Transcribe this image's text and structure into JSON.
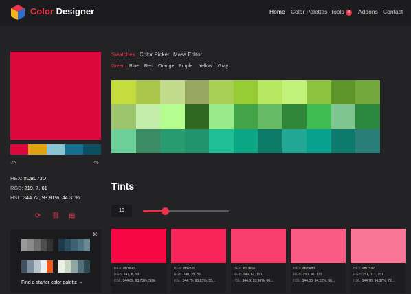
{
  "header": {
    "brand_prefix": "Color",
    "brand_suffix": " Designer",
    "nav": [
      "Home",
      "Color Palettes",
      "Tools",
      "Addons",
      "Contact"
    ],
    "tools_badge": "8"
  },
  "color": {
    "hex_value": "#DB073D",
    "hex_label": "HEX: ",
    "rgb_label": "RGB: ",
    "rgb": "219, 7, 61",
    "hsl_label": "HSL: ",
    "hsl": "344.72, 93.81%, 44.31%"
  },
  "palette": [
    "#DB073D",
    "#E0A30F",
    "#89C4D3",
    "#136E90",
    "#0B4F62"
  ],
  "starter": {
    "find_label": "Find a starter color palette",
    "palettes": [
      [
        "#9a9a9a",
        "#8a8a8a",
        "#6e6e6e",
        "#4e4e4e",
        "#333333"
      ],
      [
        "#1f3a4a",
        "#2c4d5e",
        "#3f6070",
        "#4f7282",
        "#6c8a96"
      ],
      [
        "#3f5161",
        "#7d8f9f",
        "#b6c4ce",
        "#eaeef0",
        "#ef5a21"
      ],
      [
        "#eaf0e3",
        "#c9d6c2",
        "#8fa7a1",
        "#50717a",
        "#2d4853"
      ]
    ]
  },
  "tabs": [
    "Swatches",
    "Color Picker",
    "Mass Editor"
  ],
  "subtabs": [
    "Green",
    "Blue",
    "Red",
    "Orange",
    "Purple",
    "Yellow",
    "Gray"
  ],
  "swatches": [
    "#c5dc3f",
    "#abc74b",
    "#c2da8c",
    "#98a860",
    "#a8d057",
    "#98cc35",
    "#b7e660",
    "#c2f17a",
    "#8cc440",
    "#5d952a",
    "#73a83c",
    "#9cc46d",
    "#c4ecaa",
    "#b6fd8f",
    "#2f6720",
    "#99ea8b",
    "#44a448",
    "#67bb67",
    "#2f8538",
    "#41bc53",
    "#7ec592",
    "#2a883f",
    "#6ccf97",
    "#3b8b64",
    "#2a9a70",
    "#21926c",
    "#1fbf96",
    "#0ba684",
    "#0d7a67",
    "#23a795",
    "#0aa090",
    "#0e7a6e",
    "#2a7e79"
  ],
  "tints": {
    "title": "Tints",
    "steps": "10",
    "hex_label": "HEX:",
    "rgb_label": "RGB:",
    "hsl_label": "HSL:",
    "items": [
      {
        "color": "#f70845",
        "hex": "#f70845",
        "rgb": "247, 8, 69",
        "hsl": "344.69, 93.73%, 50%"
      },
      {
        "color": "#f82359",
        "hex": "#f82359",
        "rgb": "248, 35, 89",
        "hsl": "344.79, 93.83%, 55..."
      },
      {
        "color": "#f93e6e",
        "hex": "#f93e6e",
        "rgb": "249, 62, 110",
        "hsl": "344.6, 93.96%, 60..."
      },
      {
        "color": "#fa5a83",
        "hex": "#fa5a83",
        "rgb": "250, 90, 131",
        "hsl": "344.63, 94.12%, 66..."
      },
      {
        "color": "#fb7597",
        "hex": "#fb7597",
        "rgb": "251, 117, 151",
        "hsl": "344.78, 94.37%, 72..."
      }
    ]
  }
}
